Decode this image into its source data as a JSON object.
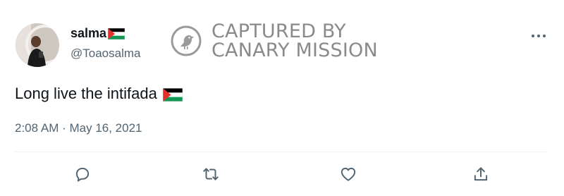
{
  "tweet": {
    "author": {
      "display_name": "salma",
      "handle": "@Toaosalma",
      "flag_icon": "palestine-flag-icon"
    },
    "text": "Long live the intifada",
    "text_flag_icon": "palestine-flag-icon",
    "timestamp": "2:08 AM · May 16, 2021"
  },
  "watermark": {
    "line1": "CAPTURED BY",
    "line2": "CANARY MISSION",
    "icon": "canary-bird-icon"
  },
  "actions": [
    {
      "name": "reply",
      "icon": "reply-icon"
    },
    {
      "name": "retweet",
      "icon": "retweet-icon"
    },
    {
      "name": "like",
      "icon": "like-heart-icon"
    },
    {
      "name": "share",
      "icon": "share-icon"
    }
  ],
  "colors": {
    "text_primary": "#0f1419",
    "text_secondary": "#536471",
    "divider": "#eff3f4",
    "watermark": "#8a8a8a"
  }
}
